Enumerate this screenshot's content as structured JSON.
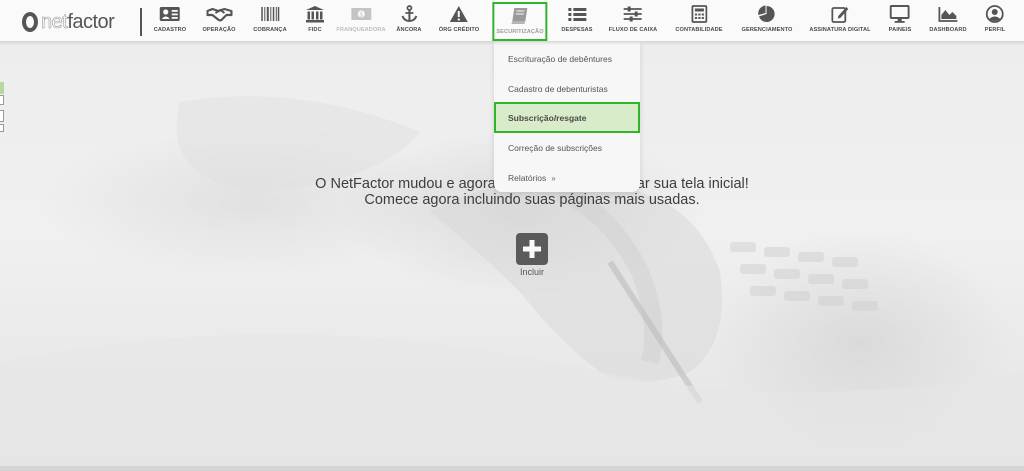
{
  "app": {
    "logo_prefix": "net",
    "logo_suffix": "factor"
  },
  "nav": [
    {
      "label": "CADASTRO",
      "icon": "id-card-icon"
    },
    {
      "label": "OPERAÇÃO",
      "icon": "handshake-icon"
    },
    {
      "label": "COBRANÇA",
      "icon": "barcode-icon"
    },
    {
      "label": "FIDC",
      "icon": "bank-icon"
    },
    {
      "label": "FRANQUEADORA",
      "icon": "money-icon",
      "disabled": true
    },
    {
      "label": "ÂNCORA",
      "icon": "anchor-icon"
    },
    {
      "label": "ÓRG CRÉDITO",
      "icon": "warning-icon"
    },
    {
      "label": "SECURITIZAÇÃO",
      "icon": "book-icon",
      "active": true
    },
    {
      "label": "DESPESAS",
      "icon": "list-icon"
    },
    {
      "label": "FLUXO DE CAIXA",
      "icon": "sliders-icon"
    },
    {
      "label": "CONTABILIDADE",
      "icon": "calculator-icon"
    },
    {
      "label": "GERENCIAMENTO",
      "icon": "pie-chart-icon"
    },
    {
      "label": "ASSINATURA DIGITAL",
      "icon": "edit-icon"
    },
    {
      "label": "PAINEIS",
      "icon": "monitor-icon"
    },
    {
      "label": "DASHBOARD",
      "icon": "area-chart-icon"
    },
    {
      "label": "PERFIL",
      "icon": "user-icon"
    }
  ],
  "dropdown": {
    "items": [
      {
        "label": "Escrituração de debêntures"
      },
      {
        "label": "Cadastro de debenturistas"
      },
      {
        "label": "Subscrição/resgate",
        "highlighted": true
      },
      {
        "label": "Correção de subscrições"
      },
      {
        "label": "Relatórios",
        "submenu_arrow": "»"
      }
    ]
  },
  "main": {
    "line1": "O NetFactor mudou e agora você pode personalizar sua tela inicial!",
    "line2": "Comece agora incluindo suas páginas mais usadas.",
    "add_label": "Incluir"
  },
  "colors": {
    "highlight_border": "#2db52d",
    "highlight_bg": "#d9ecc9",
    "icon": "#555555"
  }
}
